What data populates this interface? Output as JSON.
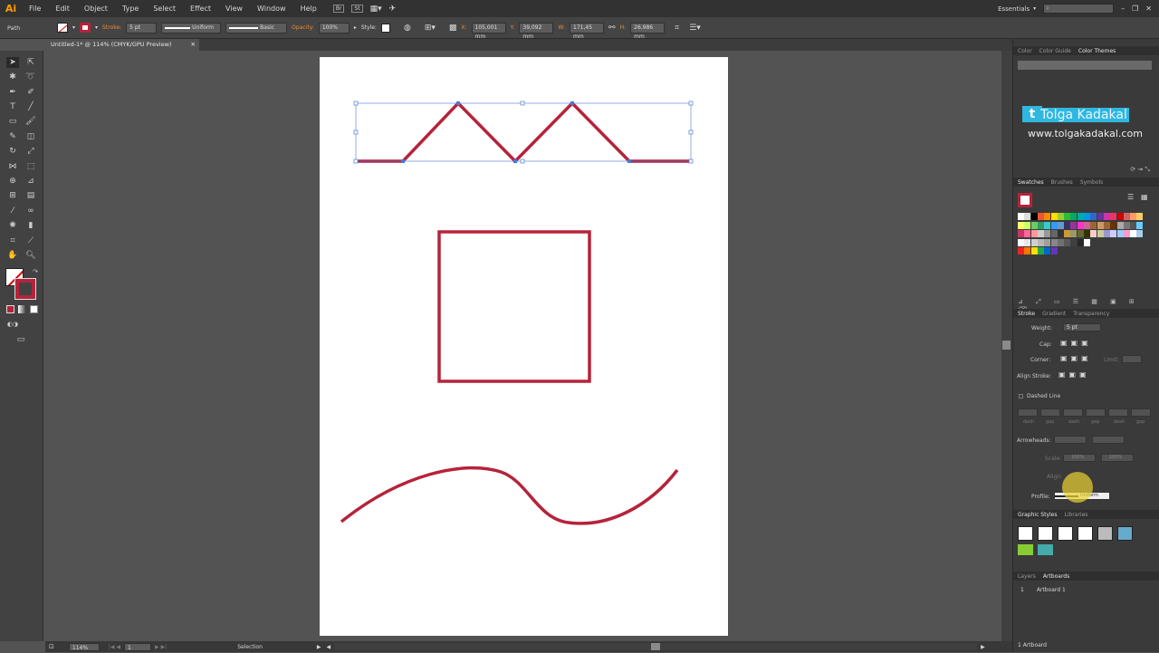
{
  "app": {
    "logo": "Ai",
    "menus": [
      "File",
      "Edit",
      "Object",
      "Type",
      "Select",
      "Effect",
      "View",
      "Window",
      "Help"
    ],
    "workspace": "Essentials",
    "search_placeholder": ""
  },
  "control": {
    "selection_type": "Path",
    "stroke_label": "Stroke:",
    "stroke_weight": "5 pt",
    "profile": "Uniform",
    "brush": "Basic",
    "opacity_label": "Opacity:",
    "opacity": "100%",
    "style_label": "Style:",
    "x_label": "X:",
    "x": "105,001 mm",
    "y_label": "Y:",
    "y": "39,092 mm",
    "w_label": "W:",
    "w": "171,45 mm",
    "h_label": "H:",
    "h": "26,986 mm"
  },
  "document": {
    "tab": "Untitled-1* @ 114% (CMYK/GPU Preview)",
    "zoom": "114%",
    "artboard_num": "1",
    "status": "Selection"
  },
  "colors": {
    "stroke_red": "#b5233a",
    "accent": "#e88d3b",
    "selection_blue": "#4a78d6"
  },
  "color_panel": {
    "tabs": [
      "Color",
      "Color Guide",
      "Color Themes"
    ],
    "active": "Color Themes",
    "watermark_name": "Tolga Kadakal",
    "watermark_url": "www.tolgakadakal.com"
  },
  "swatches_panel": {
    "tabs": [
      "Swatches",
      "Brushes",
      "Symbols"
    ]
  },
  "stroke_panel": {
    "tabs": [
      "Stroke",
      "Gradient",
      "Transparency"
    ],
    "weight_label": "Weight:",
    "weight": "5 pt",
    "cap_label": "Cap:",
    "corner_label": "Corner:",
    "limit_label": "Limit:",
    "align_label": "Align Stroke:",
    "dashed_label": "Dashed Line",
    "dash_labels": [
      "dash",
      "gap",
      "dash",
      "gap",
      "dash",
      "gap"
    ],
    "arrowheads_label": "Arrowheads:",
    "scale_label": "Scale:",
    "scale_a": "100%",
    "scale_b": "100%",
    "align2_label": "Align:",
    "profile_label": "Profile:",
    "profile": "Uniform"
  },
  "graphic_styles": {
    "tabs": [
      "Graphic Styles",
      "Libraries"
    ]
  },
  "layers": {
    "tabs": [
      "Layers",
      "Artboards"
    ],
    "artboard_index": "1",
    "artboard_name": "Artboard 1",
    "count": "1 Artboard"
  }
}
